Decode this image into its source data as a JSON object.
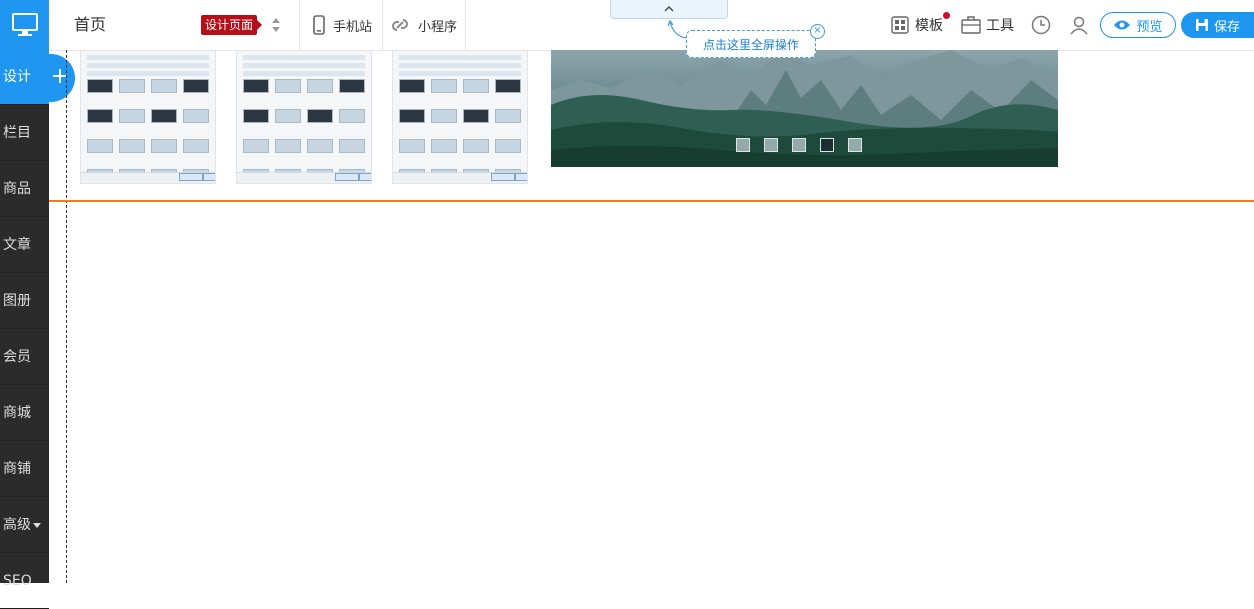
{
  "sidebar": {
    "items": [
      {
        "label": "设计",
        "active": true
      },
      {
        "label": "栏目"
      },
      {
        "label": "商品"
      },
      {
        "label": "文章"
      },
      {
        "label": "图册"
      },
      {
        "label": "会员"
      },
      {
        "label": "商城"
      },
      {
        "label": "商铺"
      },
      {
        "label": "高级",
        "has_dropdown": true
      },
      {
        "label": "SEO"
      }
    ],
    "add_icon": "+"
  },
  "header": {
    "page_name": "首页",
    "page_badge": "设计页面",
    "mobile_label": "手机站",
    "miniprogram_label": "小程序",
    "template_label": "模板",
    "tools_label": "工具",
    "preview_label": "预览",
    "save_label": "保存"
  },
  "fullscreen_tip": {
    "text": "点击这里全屏操作",
    "close": "×"
  },
  "colors": {
    "accent": "#1e96f0",
    "sidebar_bg": "#2b2b2b",
    "badge": "#b5101a",
    "divider": "#f07c1c"
  },
  "banner": {
    "slide_count": 5,
    "active_slide": 4
  },
  "icons": [
    "desktop-icon",
    "updown-icon",
    "mobile-icon",
    "link-icon",
    "template-icon",
    "toolbox-icon",
    "history-icon",
    "user-icon",
    "eye-icon",
    "save-icon",
    "chevron-up-icon"
  ]
}
